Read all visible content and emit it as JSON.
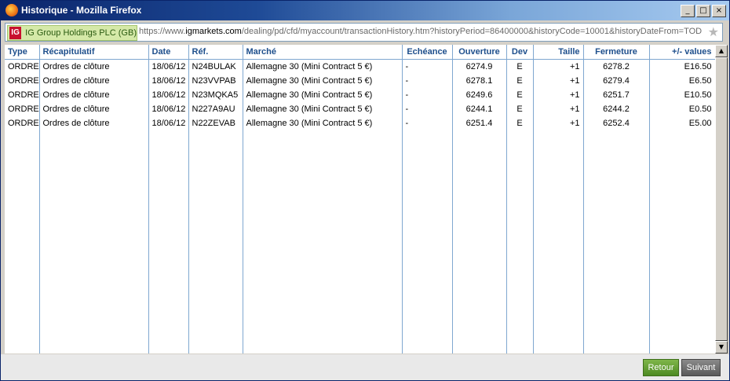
{
  "window": {
    "title": "Historique - Mozilla Firefox",
    "controls": {
      "minimize": "_",
      "maximize": "□",
      "close": "×"
    }
  },
  "urlbar": {
    "site_identity": "IG Group Holdings PLC (GB)",
    "logo_text": "IG",
    "url_prefix": "https://www.",
    "url_domain": "igmarkets.com",
    "url_rest": "/dealing/pd/cfd/myaccount/transactionHistory.htm?historyPeriod=86400000&historyCode=10001&historyDateFrom=TOD"
  },
  "table": {
    "headers": [
      "Type",
      "Récapitulatif",
      "Date",
      "Réf.",
      "Marché",
      "Echéance",
      "Ouverture",
      "Dev",
      "Taille",
      "Fermeture",
      "+/- values"
    ],
    "rows": [
      [
        "ORDRE",
        "Ordres de clôture",
        "18/06/12",
        "N24BULAK",
        "Allemagne 30 (Mini Contract 5 €)",
        "-",
        "6274.9",
        "E",
        "+1",
        "6278.2",
        "E16.50"
      ],
      [
        "ORDRE",
        "Ordres de clôture",
        "18/06/12",
        "N23VVPAB",
        "Allemagne 30 (Mini Contract 5 €)",
        "-",
        "6278.1",
        "E",
        "+1",
        "6279.4",
        "E6.50"
      ],
      [
        "ORDRE",
        "Ordres de clôture",
        "18/06/12",
        "N23MQKA5",
        "Allemagne 30 (Mini Contract 5 €)",
        "-",
        "6249.6",
        "E",
        "+1",
        "6251.7",
        "E10.50"
      ],
      [
        "ORDRE",
        "Ordres de clôture",
        "18/06/12",
        "N227A9AU",
        "Allemagne 30 (Mini Contract 5 €)",
        "-",
        "6244.1",
        "E",
        "+1",
        "6244.2",
        "E0.50"
      ],
      [
        "ORDRE",
        "Ordres de clôture",
        "18/06/12",
        "N22ZEVAB",
        "Allemagne 30 (Mini Contract 5 €)",
        "-",
        "6251.4",
        "E",
        "+1",
        "6252.4",
        "E5.00"
      ]
    ]
  },
  "footer": {
    "back_label": "Retour",
    "next_label": "Suivant"
  },
  "colors": {
    "header_text": "#1e4f8c",
    "back_button": "#5e9a2e",
    "next_button": "#6a6a6a",
    "titlebar": "#0a246a"
  },
  "icons": [
    "firefox-icon",
    "ig-logo",
    "bookmark-star-icon",
    "scroll-up-icon",
    "scroll-down-icon"
  ]
}
